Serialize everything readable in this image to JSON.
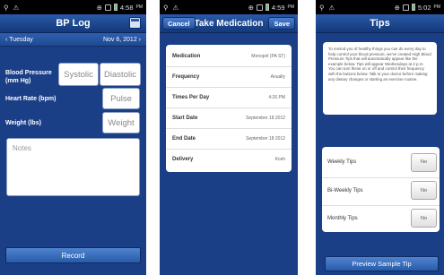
{
  "screen1": {
    "status": {
      "time": "4:58",
      "ampm": "PM"
    },
    "title": "BP Log",
    "date_left": "Tuesday",
    "date_right": "Nov 6, 2012",
    "rows": {
      "bp_label_1": "Blood Pressure",
      "bp_label_2": "(mm Hg)",
      "hr_label": "Heart Rate (bpm)",
      "wt_label": "Weight (lbs)"
    },
    "placeholders": {
      "systolic": "Systolic",
      "diastolic": "Diastolic",
      "pulse": "Pulse",
      "weight": "Weight",
      "notes": "Notes"
    },
    "record_button": "Record"
  },
  "screen2": {
    "status": {
      "time": "4:59",
      "ampm": "PM"
    },
    "cancel_button": "Cancel",
    "title": "Take Medication",
    "save_button": "Save",
    "rows": [
      {
        "label": "Medication",
        "value": "Monopril (PA ST)"
      },
      {
        "label": "Frequency",
        "value": "Anually"
      },
      {
        "label": "Times Per Day",
        "value": "4:26 PM"
      },
      {
        "label": "Start Date",
        "value": "September 18 2012"
      },
      {
        "label": "End Date",
        "value": "September 18 2012"
      },
      {
        "label": "Delivery",
        "value": "Kosh"
      }
    ]
  },
  "screen3": {
    "status": {
      "time": "5:02",
      "ampm": "PM"
    },
    "title": "Tips",
    "tips_text": "To remind you of healthy things you can do every day to help control your blood pressure, we've created High Blood Pressure Tips that will automatically appear like the example below. Tips will appear Wednesdays at 2 p.m. You can turn these on or off and control their frequency with the buttons below. Talk to your doctor before making any dietary changes or starting an exercise routine.",
    "toggles": [
      {
        "label": "Weekly Tips",
        "state": "No"
      },
      {
        "label": "Bi-Weekly Tips",
        "state": "No"
      },
      {
        "label": "Monthly Tips",
        "state": "No"
      }
    ],
    "preview_button": "Preview Sample Tip"
  }
}
